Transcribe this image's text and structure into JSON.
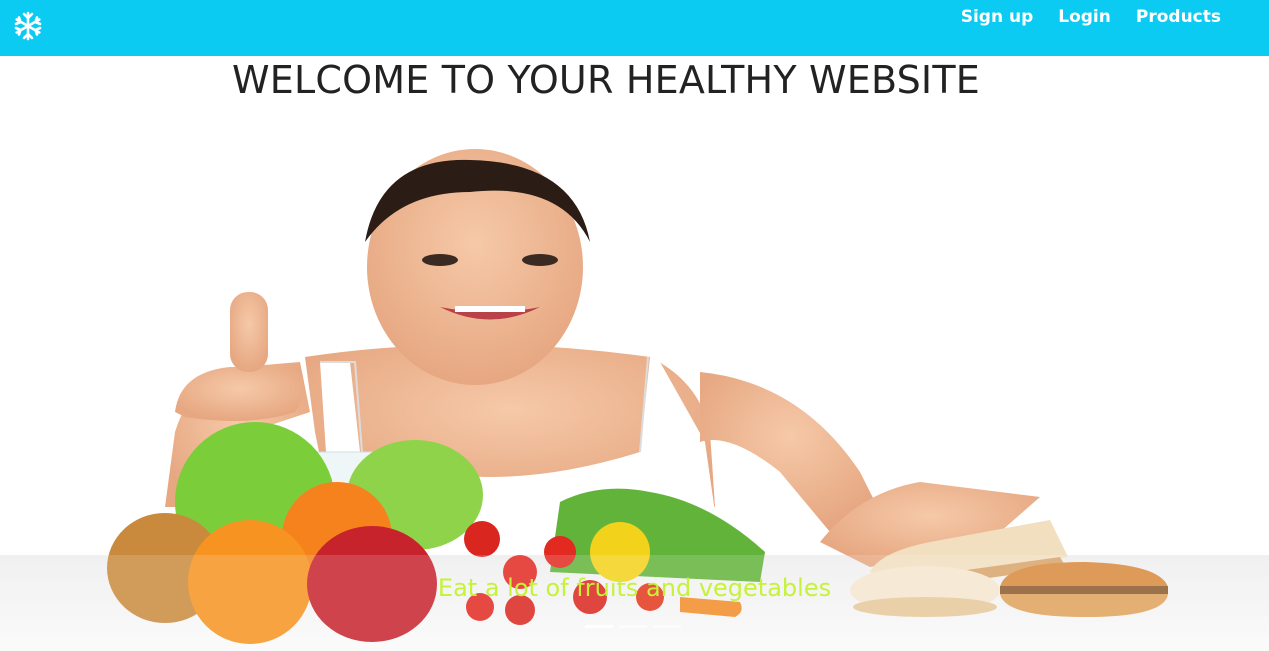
{
  "navbar": {
    "brand_icon": "snowflake-icon",
    "background": "#0ccbf2",
    "links": [
      {
        "label": "Sign up"
      },
      {
        "label": "Login"
      },
      {
        "label": "Products"
      }
    ]
  },
  "page": {
    "title": "WELCOME TO YOUR HEALTHY WEBSITE"
  },
  "carousel": {
    "caption": "Eat a lot of fruits and vegetables",
    "caption_color": "#c6f23a",
    "slide_count": 3,
    "active_index": 0
  }
}
